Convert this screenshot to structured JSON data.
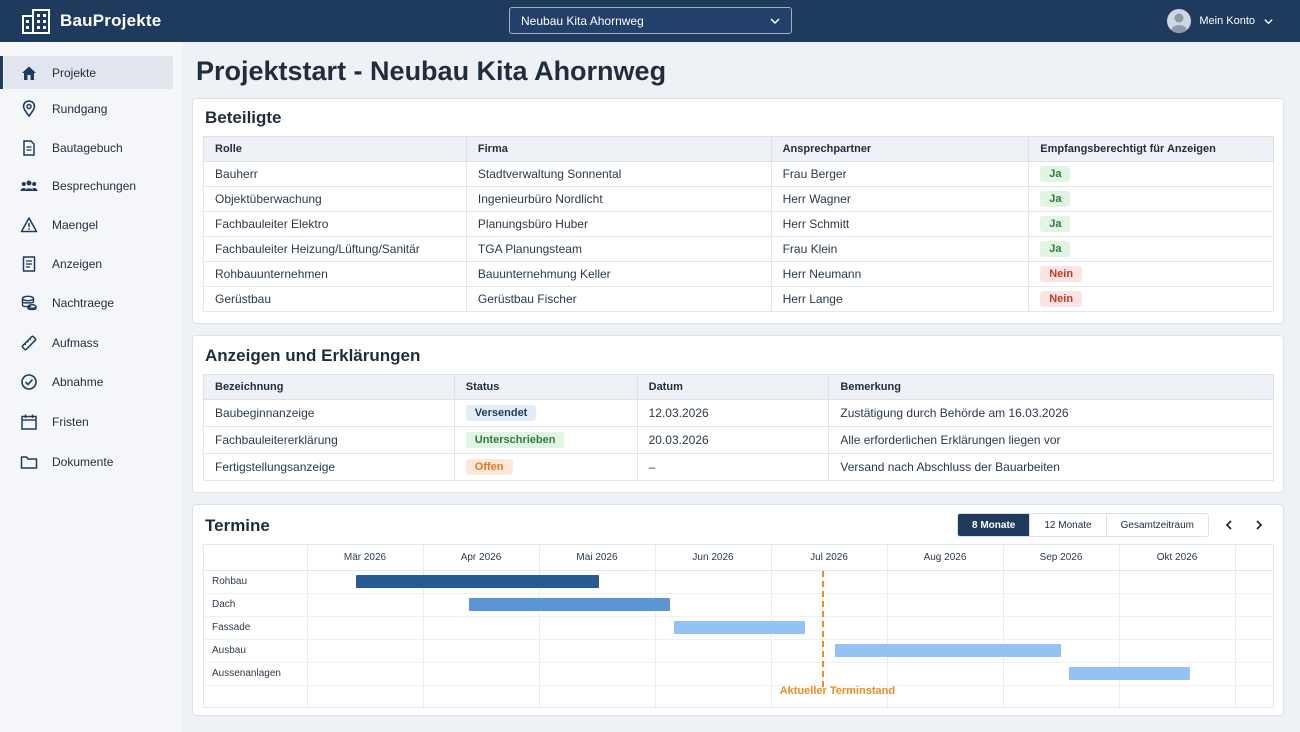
{
  "app": {
    "name": "BauProjekte"
  },
  "project_selector": {
    "value": "Neubau Kita Ahornweg"
  },
  "account": {
    "label": "Mein Konto"
  },
  "sidebar": {
    "items": [
      {
        "label": "Projekte",
        "icon": "home-icon"
      },
      {
        "label": "Rundgang",
        "icon": "map-pin-icon"
      },
      {
        "label": "Bautagebuch",
        "icon": "document-icon"
      },
      {
        "label": "Besprechungen",
        "icon": "users-icon"
      },
      {
        "label": "Maengel",
        "icon": "warning-icon"
      },
      {
        "label": "Anzeigen",
        "icon": "list-document-icon"
      },
      {
        "label": "Nachtraege",
        "icon": "coins-icon"
      },
      {
        "label": "Aufmass",
        "icon": "ruler-icon"
      },
      {
        "label": "Abnahme",
        "icon": "check-circle-icon"
      },
      {
        "label": "Fristen",
        "icon": "calendar-icon"
      },
      {
        "label": "Dokumente",
        "icon": "folder-icon"
      }
    ]
  },
  "page": {
    "title": "Projektstart - Neubau Kita Ahornweg"
  },
  "beteiligte": {
    "title": "Beteiligte",
    "columns": [
      "Rolle",
      "Firma",
      "Ansprechpartner",
      "Empfangsberechtigt für Anzeigen"
    ],
    "rows": [
      {
        "rolle": "Bauherr",
        "firma": "Stadtverwaltung Sonnental",
        "ansprechpartner": "Frau Berger",
        "empfang": "Ja"
      },
      {
        "rolle": "Objektüberwachung",
        "firma": "Ingenieurbüro Nordlicht",
        "ansprechpartner": "Herr Wagner",
        "empfang": "Ja"
      },
      {
        "rolle": "Fachbauleiter Elektro",
        "firma": "Planungsbüro Huber",
        "ansprechpartner": "Herr Schmitt",
        "empfang": "Ja"
      },
      {
        "rolle": "Fachbauleiter Heizung/Lüftung/Sanitär",
        "firma": "TGA Planungsteam",
        "ansprechpartner": "Frau Klein",
        "empfang": "Ja"
      },
      {
        "rolle": "Rohbauunternehmen",
        "firma": "Bauunternehmung Keller",
        "ansprechpartner": "Herr Neumann",
        "empfang": "Nein"
      },
      {
        "rolle": "Gerüstbau",
        "firma": "Gerüstbau Fischer",
        "ansprechpartner": "Herr Lange",
        "empfang": "Nein"
      }
    ]
  },
  "anzeigen": {
    "title": "Anzeigen und Erklärungen",
    "columns": [
      "Bezeichnung",
      "Status",
      "Datum",
      "Bemerkung"
    ],
    "rows": [
      {
        "bezeichnung": "Baubeginnanzeige",
        "status": "Versendet",
        "status_type": "sent",
        "datum": "12.03.2026",
        "bemerkung": "Zustätigung durch Behörde am 16.03.2026"
      },
      {
        "bezeichnung": "Fachbauleitererklärung",
        "status": "Unterschrieben",
        "status_type": "sign",
        "datum": "20.03.2026",
        "bemerkung": "Alle erforderlichen Erklärungen liegen vor"
      },
      {
        "bezeichnung": "Fertigstellungsanzeige",
        "status": "Offen",
        "status_type": "open",
        "datum": "–",
        "bemerkung": "Versand nach Abschluss der Bauarbeiten"
      }
    ]
  },
  "termine": {
    "title": "Termine",
    "ranges": [
      "8 Monate",
      "12 Monate",
      "Gesamtzeitraum"
    ],
    "active_range": "8 Monate",
    "months": [
      "Mär 2026",
      "Apr 2026",
      "Mai 2026",
      "Jun 2026",
      "Jul 2026",
      "Aug 2026",
      "Sep 2026",
      "Okt 2026"
    ],
    "today_label": "Aktueller Terminstand",
    "today_date": "2026-07-15",
    "colors": {
      "dark": "#2a5a92",
      "medium": "#5b95d6",
      "light": "#94c2f2",
      "today": "#f08a24"
    },
    "tasks": [
      {
        "name": "Rohbau",
        "start": "2026-03-14",
        "end": "2026-05-17",
        "shade": "dark"
      },
      {
        "name": "Dach",
        "start": "2026-04-13",
        "end": "2026-06-05",
        "shade": "medium"
      },
      {
        "name": "Fassade",
        "start": "2026-06-06",
        "end": "2026-07-10",
        "shade": "light"
      },
      {
        "name": "Ausbau",
        "start": "2026-07-18",
        "end": "2026-09-16",
        "shade": "light"
      },
      {
        "name": "Aussenanlagen",
        "start": "2026-09-18",
        "end": "2026-10-20",
        "shade": "light"
      }
    ]
  }
}
